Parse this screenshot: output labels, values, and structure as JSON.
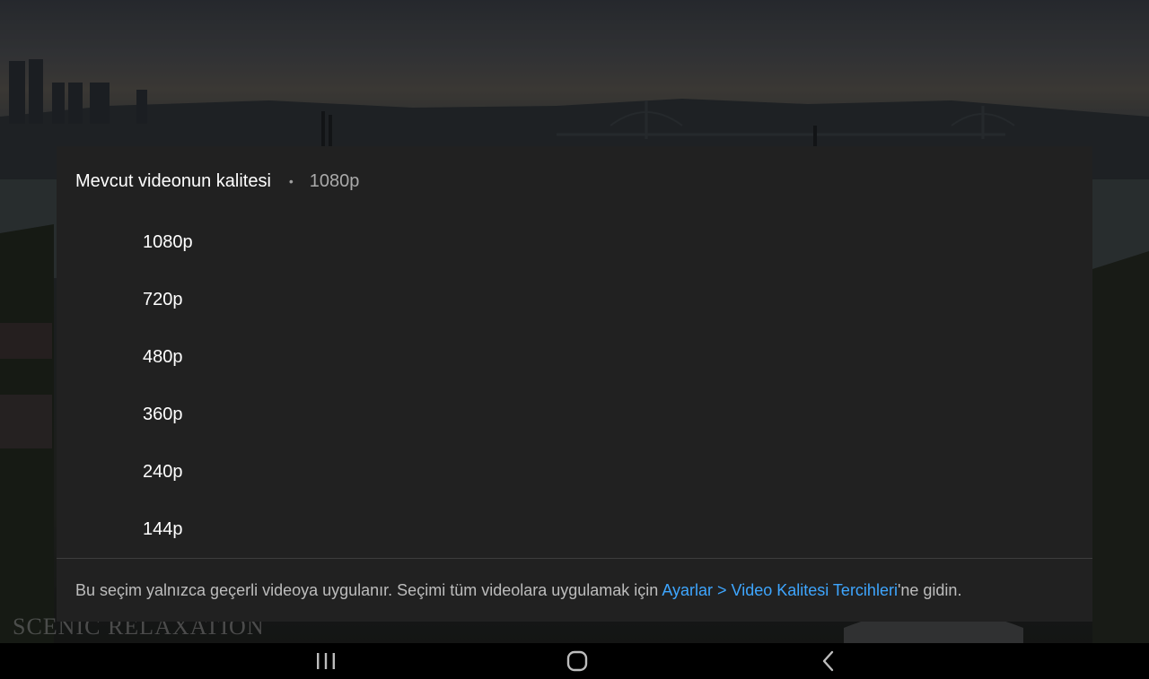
{
  "video": {
    "watermark": "SCENIC RELAXATION"
  },
  "quality_dialog": {
    "title": "Mevcut videonun kalitesi",
    "separator": "•",
    "current_quality": "1080p",
    "options": [
      "1080p",
      "720p",
      "480p",
      "360p",
      "240p",
      "144p"
    ],
    "footer": {
      "text_before": "Bu seçim yalnızca geçerli videoya uygulanır. Seçimi tüm videolara uygulamak için ",
      "link": "Ayarlar > Video Kalitesi Tercihleri",
      "text_after": "'ne gidin."
    }
  },
  "nav_bar": {
    "icons": [
      "recent-apps-icon",
      "home-icon",
      "back-icon"
    ]
  },
  "colors": {
    "dialog_bg": "#212121",
    "link": "#3ea6ff",
    "primary_text": "#ffffff",
    "secondary_text": "#aaaaaa"
  }
}
